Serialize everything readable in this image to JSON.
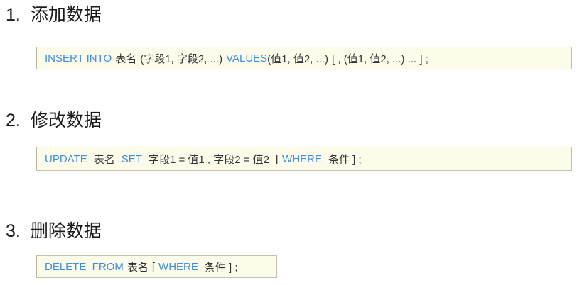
{
  "sections": [
    {
      "number": "1.",
      "title": "添加数据",
      "syntax": {
        "kw_insert_into": "INSERT INTO",
        "table": "表名",
        "fields": "(字段1, 字段2, ...)",
        "kw_values": "VALUES",
        "values": "(值1, 值2, ...)",
        "more": "[ , (值1, 值2, ...)  ... ] ;"
      }
    },
    {
      "number": "2.",
      "title": "修改数据",
      "syntax": {
        "kw_update": "UPDATE",
        "table": "表名",
        "kw_set": "SET",
        "assign": "字段1 = 值1 , 字段2 = 值2",
        "open": "[",
        "kw_where": "WHERE",
        "cond": "条件 ] ;"
      }
    },
    {
      "number": "3.",
      "title": "删除数据",
      "syntax": {
        "kw_delete_from": "DELETE  FROM",
        "table": "表名",
        "open": "[",
        "kw_where": "WHERE",
        "cond": "条件 ] ;"
      }
    }
  ],
  "colors": {
    "keyword": "#3b8ee0",
    "code_background": "#fdfbea"
  }
}
